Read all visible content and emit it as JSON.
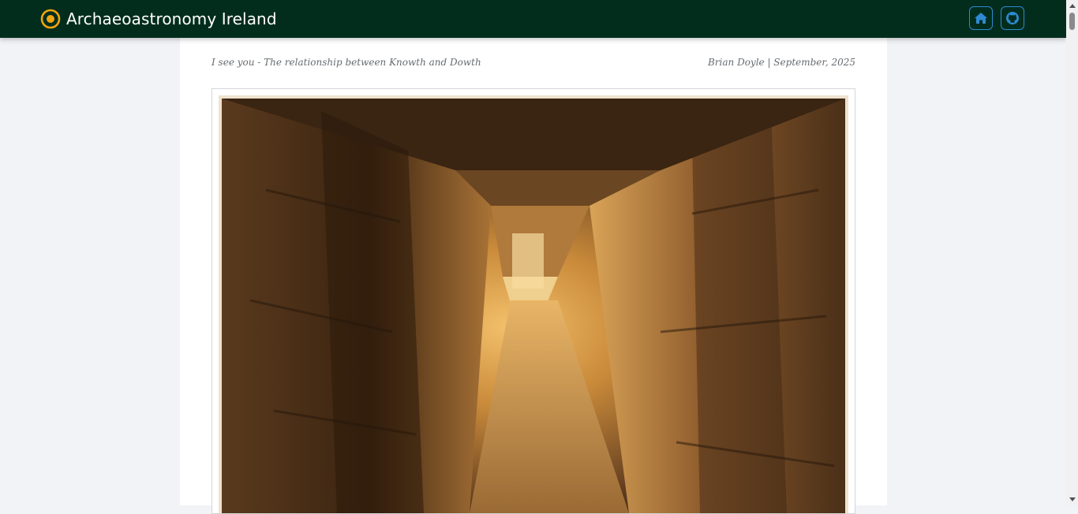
{
  "header": {
    "title": "Archaeoastronomy Ireland",
    "logo_icon": "sun-target-icon",
    "nav": [
      {
        "icon": "home-icon",
        "label": "Home"
      },
      {
        "icon": "github-icon",
        "label": "GitHub"
      }
    ],
    "colors": {
      "bar": "#022d1d",
      "logo": "#f2a40f",
      "nav_border": "#2f8ad1",
      "nav_icon": "#2f8ad1"
    }
  },
  "article": {
    "subtitle": "I see you - The relationship between Knowth and Dowth",
    "byline": "Brian Doyle | September, 2025"
  },
  "figure": {
    "icon": "passage-tomb-photo"
  }
}
